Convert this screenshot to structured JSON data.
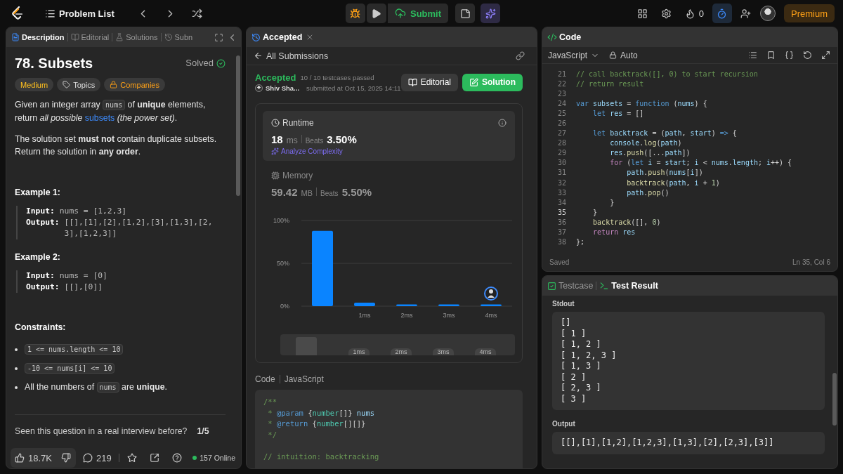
{
  "topbar": {
    "title": "Problem List",
    "submit": "Submit",
    "streak": "0",
    "premium": "Premium"
  },
  "description_panel": {
    "tabs": [
      {
        "label": "Description",
        "kind": "description",
        "selected": true
      },
      {
        "label": "Editorial",
        "kind": "editorial",
        "selected": false
      },
      {
        "label": "Solutions",
        "kind": "solutions",
        "selected": false
      },
      {
        "label": "Subn",
        "kind": "submissions",
        "selected": false
      }
    ],
    "title": "78. Subsets",
    "status": "Solved",
    "tags": [
      {
        "label": "Medium",
        "kind": "difficulty"
      },
      {
        "label": "Topics",
        "kind": "topics"
      },
      {
        "label": "Companies",
        "kind": "companies"
      }
    ],
    "paragraphs": [
      [
        {
          "kind": "text",
          "text": "Given an integer array "
        },
        {
          "kind": "code",
          "text": "nums"
        },
        {
          "kind": "text",
          "text": " of **unique** elements, return *all possible* "
        },
        {
          "kind": "link",
          "text": "subsets"
        },
        {
          "kind": "text",
          "text": " *(the power set)*."
        }
      ],
      [
        {
          "kind": "text",
          "text": "The solution set **must not** contain duplicate subsets. Return the solution in **any order**."
        }
      ]
    ],
    "examples": [
      {
        "title": "Example 1:",
        "lines": [
          {
            "label": "Input:",
            "value": "nums = [1,2,3]"
          },
          {
            "label": "Output:",
            "value": "[[],[1],[2],[1,2],[3],[1,3],[2,3],[1,2,3]]"
          }
        ]
      },
      {
        "title": "Example 2:",
        "lines": [
          {
            "label": "Input:",
            "value": "nums = [0]"
          },
          {
            "label": "Output:",
            "value": "[[],[0]]"
          }
        ]
      }
    ],
    "constraints_title": "Constraints:",
    "constraints": [
      [
        {
          "kind": "code",
          "text": "1 <= nums.length <= 10"
        }
      ],
      [
        {
          "kind": "code",
          "text": "-10 <= nums[i] <= 10"
        }
      ],
      [
        {
          "kind": "text",
          "text": "All the numbers of "
        },
        {
          "kind": "code",
          "text": "nums"
        },
        {
          "kind": "text",
          "text": " are **unique**."
        }
      ]
    ],
    "interview": {
      "question": "Seen this question in a real interview before?",
      "count": "1/5"
    },
    "footer": {
      "likes": "18.7K",
      "comments": "219",
      "online": "157 Online"
    }
  },
  "submission_panel": {
    "tab": "Accepted",
    "back": "All Submissions",
    "status": "Accepted",
    "testcases": "10 / 10 testcases passed",
    "user": "Shiv Sha...",
    "submitted": "submitted at Oct 15, 2025 14:11",
    "buttons": [
      {
        "label": "Editorial",
        "kind": "editorial"
      },
      {
        "label": "Solution",
        "kind": "solution"
      }
    ],
    "runtime": {
      "label": "Runtime",
      "value": "18",
      "unit": "ms",
      "beats_label": "Beats",
      "beats": "3.50%",
      "analyze": "Analyze Complexity"
    },
    "memory": {
      "label": "Memory",
      "value": "59.42",
      "unit": "MB",
      "beats_label": "Beats",
      "beats": "5.50%"
    },
    "chart_data": {
      "type": "bar",
      "categories": [
        null,
        "1ms",
        "2ms",
        "3ms",
        "4ms"
      ],
      "series": [
        {
          "color": "#0a84ff",
          "values": [
            88,
            4,
            2,
            2,
            2
          ]
        }
      ],
      "ylim": [
        0,
        100
      ],
      "yticks": [
        {
          "value": 0,
          "label": "0%"
        },
        {
          "value": 50,
          "label": "50%"
        },
        {
          "value": 100,
          "label": "100%"
        }
      ],
      "annotations": [
        {
          "x": "4ms"
        }
      ]
    },
    "navigator": {
      "labels": [
        "1ms",
        "2ms",
        "3ms",
        "4ms"
      ]
    },
    "code_label": "Code",
    "code_language": "JavaScript",
    "code_blocks": [
      {
        "lines": [
          {
            "tokens": [
              {
                "kind": "comment",
                "text": "/**"
              }
            ]
          },
          {
            "tokens": [
              {
                "kind": "comment",
                "text": " * "
              },
              {
                "kind": "keyword",
                "text": "@param"
              },
              {
                "kind": "plain",
                "text": " {"
              },
              {
                "kind": "type",
                "text": "number"
              },
              {
                "kind": "plain",
                "text": "[]} "
              },
              {
                "kind": "variable",
                "text": "nums"
              }
            ]
          },
          {
            "tokens": [
              {
                "kind": "comment",
                "text": " * "
              },
              {
                "kind": "keyword",
                "text": "@return"
              },
              {
                "kind": "plain",
                "text": " {"
              },
              {
                "kind": "type",
                "text": "number"
              },
              {
                "kind": "plain",
                "text": "[][]}"
              }
            ]
          },
          {
            "tokens": [
              {
                "kind": "comment",
                "text": " */"
              }
            ]
          }
        ]
      },
      {
        "lines": [
          {
            "tokens": [
              {
                "kind": "comment",
                "text": "// intuition: backtracking"
              }
            ]
          }
        ]
      }
    ]
  },
  "code_panel": {
    "title": "Code",
    "language": "JavaScript",
    "mode": "Auto",
    "saved": "Saved",
    "cursor": "Ln 35, Col 6",
    "lines": [
      {
        "number": "21",
        "current": false,
        "tokens": [
          {
            "kind": "comment",
            "text": "// call backtrack([], 0) to start recursion"
          }
        ]
      },
      {
        "number": "22",
        "current": false,
        "tokens": [
          {
            "kind": "comment",
            "text": "// return result"
          }
        ]
      },
      {
        "number": "23",
        "current": false
      },
      {
        "number": "24",
        "current": false,
        "tokens": [
          {
            "kind": "keyword",
            "text": "var"
          },
          {
            "kind": "variable",
            "text": " subsets"
          },
          {
            "kind": "plain",
            "text": " = "
          },
          {
            "kind": "keyword",
            "text": "function"
          },
          {
            "kind": "plain",
            "text": " ("
          },
          {
            "kind": "variable",
            "text": "nums"
          },
          {
            "kind": "plain",
            "text": ") {"
          }
        ]
      },
      {
        "number": "25",
        "current": false,
        "tokens": [
          {
            "kind": "keyword",
            "text": "    let"
          },
          {
            "kind": "variable",
            "text": " res"
          },
          {
            "kind": "plain",
            "text": " = []"
          }
        ]
      },
      {
        "number": "26",
        "current": false
      },
      {
        "number": "27",
        "current": false,
        "tokens": [
          {
            "kind": "keyword",
            "text": "    let"
          },
          {
            "kind": "variable",
            "text": " backtrack"
          },
          {
            "kind": "plain",
            "text": " = ("
          },
          {
            "kind": "variable",
            "text": "path"
          },
          {
            "kind": "plain",
            "text": ", "
          },
          {
            "kind": "variable",
            "text": "start"
          },
          {
            "kind": "plain",
            "text": ") "
          },
          {
            "kind": "keyword",
            "text": "=>"
          },
          {
            "kind": "plain",
            "text": " {"
          }
        ]
      },
      {
        "number": "28",
        "current": false,
        "tokens": [
          {
            "kind": "variable",
            "text": "        console"
          },
          {
            "kind": "plain",
            "text": "."
          },
          {
            "kind": "function",
            "text": "log"
          },
          {
            "kind": "plain",
            "text": "("
          },
          {
            "kind": "variable",
            "text": "path"
          },
          {
            "kind": "plain",
            "text": ")"
          }
        ]
      },
      {
        "number": "29",
        "current": false,
        "tokens": [
          {
            "kind": "variable",
            "text": "        res"
          },
          {
            "kind": "plain",
            "text": "."
          },
          {
            "kind": "function",
            "text": "push"
          },
          {
            "kind": "plain",
            "text": "([..."
          },
          {
            "kind": "variable",
            "text": "path"
          },
          {
            "kind": "plain",
            "text": "])"
          }
        ]
      },
      {
        "number": "30",
        "current": false,
        "tokens": [
          {
            "kind": "control",
            "text": "        for"
          },
          {
            "kind": "plain",
            "text": " ("
          },
          {
            "kind": "keyword",
            "text": "let"
          },
          {
            "kind": "variable",
            "text": " i"
          },
          {
            "kind": "plain",
            "text": " = "
          },
          {
            "kind": "variable",
            "text": "start"
          },
          {
            "kind": "plain",
            "text": "; "
          },
          {
            "kind": "variable",
            "text": "i"
          },
          {
            "kind": "plain",
            "text": " < "
          },
          {
            "kind": "variable",
            "text": "nums"
          },
          {
            "kind": "plain",
            "text": "."
          },
          {
            "kind": "variable",
            "text": "length"
          },
          {
            "kind": "plain",
            "text": "; "
          },
          {
            "kind": "variable",
            "text": "i"
          },
          {
            "kind": "plain",
            "text": "++) {"
          }
        ]
      },
      {
        "number": "31",
        "current": false,
        "tokens": [
          {
            "kind": "variable",
            "text": "            path"
          },
          {
            "kind": "plain",
            "text": "."
          },
          {
            "kind": "function",
            "text": "push"
          },
          {
            "kind": "plain",
            "text": "("
          },
          {
            "kind": "variable",
            "text": "nums"
          },
          {
            "kind": "plain",
            "text": "["
          },
          {
            "kind": "variable",
            "text": "i"
          },
          {
            "kind": "plain",
            "text": "])"
          }
        ]
      },
      {
        "number": "32",
        "current": false,
        "tokens": [
          {
            "kind": "function",
            "text": "            backtrack"
          },
          {
            "kind": "plain",
            "text": "("
          },
          {
            "kind": "variable",
            "text": "path"
          },
          {
            "kind": "plain",
            "text": ", "
          },
          {
            "kind": "variable",
            "text": "i"
          },
          {
            "kind": "plain",
            "text": " + "
          },
          {
            "kind": "number",
            "text": "1"
          },
          {
            "kind": "plain",
            "text": ")"
          }
        ]
      },
      {
        "number": "33",
        "current": false,
        "tokens": [
          {
            "kind": "variable",
            "text": "            path"
          },
          {
            "kind": "plain",
            "text": "."
          },
          {
            "kind": "function",
            "text": "pop"
          },
          {
            "kind": "plain",
            "text": "()"
          }
        ]
      },
      {
        "number": "34",
        "current": false,
        "tokens": [
          {
            "kind": "plain",
            "text": "        }"
          }
        ]
      },
      {
        "number": "35",
        "current": true,
        "tokens": [
          {
            "kind": "plain",
            "text": "    }"
          }
        ]
      },
      {
        "number": "36",
        "current": false,
        "tokens": [
          {
            "kind": "function",
            "text": "    backtrack"
          },
          {
            "kind": "plain",
            "text": "([], "
          },
          {
            "kind": "number",
            "text": "0"
          },
          {
            "kind": "plain",
            "text": ")"
          }
        ]
      },
      {
        "number": "37",
        "current": false,
        "tokens": [
          {
            "kind": "control",
            "text": "    return"
          },
          {
            "kind": "variable",
            "text": " res"
          }
        ]
      },
      {
        "number": "38",
        "current": false,
        "tokens": [
          {
            "kind": "plain",
            "text": "};"
          }
        ]
      }
    ]
  },
  "result_panel": {
    "tabs": [
      {
        "label": "Testcase",
        "kind": "testcase",
        "selected": false
      },
      {
        "label": "Test Result",
        "kind": "result",
        "selected": true
      }
    ],
    "stdout_label": "Stdout",
    "stdout": [
      "[]",
      "[ 1 ]",
      "[ 1, 2 ]",
      "[ 1, 2, 3 ]",
      "[ 1, 3 ]",
      "[ 2 ]",
      "[ 2, 3 ]",
      "[ 3 ]"
    ],
    "output_label": "Output",
    "output": "[[],[1],[1,2],[1,2,3],[1,3],[2],[2,3],[3]]"
  }
}
